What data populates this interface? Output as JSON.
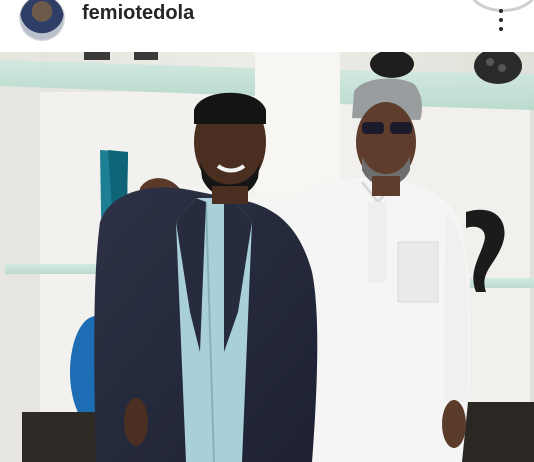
{
  "post": {
    "username": "femiotedola"
  },
  "icons": {
    "avatar": "profile-avatar",
    "more": "more-options-icon"
  },
  "colors": {
    "username_text": "#262626",
    "background": "#ffffff"
  }
}
